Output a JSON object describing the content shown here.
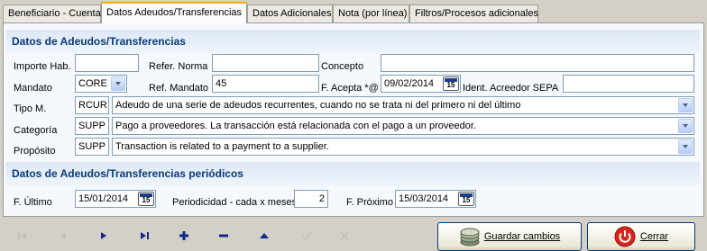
{
  "tabs": [
    {
      "label": "Beneficiario - Cuenta"
    },
    {
      "label": "Datos Adeudos/Transferencias"
    },
    {
      "label": "Datos Adicionales"
    },
    {
      "label": "Nota (por línea)"
    },
    {
      "label": "Filtros/Procesos adicionales"
    }
  ],
  "section1": {
    "title": "Datos de Adeudos/Transferencias",
    "importe_hab_label": "Importe Hab.",
    "importe_hab_value": "",
    "refer_norma_label": "Refer. Norma",
    "refer_norma_value": "",
    "concepto_label": "Concepto",
    "concepto_value": "",
    "mandato_label": "Mandato",
    "mandato_value": "CORE",
    "ref_mandato_label": "Ref. Mandato",
    "ref_mandato_value": "45",
    "f_acepta_label": "F. Acepta *@",
    "f_acepta_value": "09/02/2014",
    "ident_acreedor_label": "Ident. Acreedor SEPA",
    "ident_acreedor_value": "",
    "tipo_m_label": "Tipo M.",
    "tipo_m_code": "RCUR",
    "tipo_m_desc": "Adeudo de una serie de adeudos recurrentes, cuando no se trata ni del primero ni del último",
    "categoria_label": "Categoría",
    "categoria_code": "SUPP",
    "categoria_desc": "Pago a proveedores. La transacción está relacionada con el pago a un proveedor.",
    "proposito_label": "Propósito",
    "proposito_code": "SUPP",
    "proposito_desc": "Transaction is related to a payment to a supplier."
  },
  "section2": {
    "title": "Datos de Adeudos/Transferencias periódicos",
    "f_ultimo_label": "F. Último",
    "f_ultimo_value": "15/01/2014",
    "periodicidad_label": "Periodicidad - cada x meses",
    "periodicidad_value": "2",
    "f_proximo_label": "F. Próximo",
    "f_proximo_value": "15/03/2014"
  },
  "calendar_icon_text": "15",
  "buttons": {
    "guardar": "Guardar cambios",
    "cerrar": "Cerrar"
  },
  "icons": {
    "nav": [
      "first-record-icon",
      "prev-record-icon",
      "next-record-icon",
      "last-record-icon",
      "add-record-icon",
      "delete-record-icon",
      "up-icon",
      "confirm-icon",
      "cancel-icon"
    ],
    "save": "save-coins-icon",
    "close": "power-close-icon"
  },
  "colors": {
    "section_title": "#0b3a78",
    "active_tab_accent": "#f4a821",
    "nav_enabled": "#102a8c",
    "nav_disabled": "#c3c1bb"
  }
}
